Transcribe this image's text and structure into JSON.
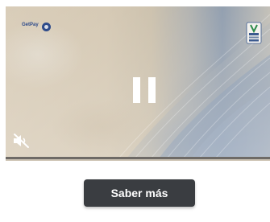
{
  "ad": {
    "cta_label": "Saber más",
    "advertiser_logo_text": "GetPay",
    "advertiser_logo_subtext": "",
    "sponsor_logo_text": "",
    "caption": ""
  },
  "player": {
    "state": "paused",
    "muted": true,
    "progress": 0
  },
  "icons": {
    "pause": "pause-icon",
    "mute": "volume-muted-icon",
    "advertiser_logo": "advertiser-logo",
    "sponsor_badge": "sponsor-badge-icon"
  },
  "colors": {
    "cta_background": "#3a3d41",
    "cta_text": "#ffffff",
    "overlay_icon": "#ffffff"
  }
}
